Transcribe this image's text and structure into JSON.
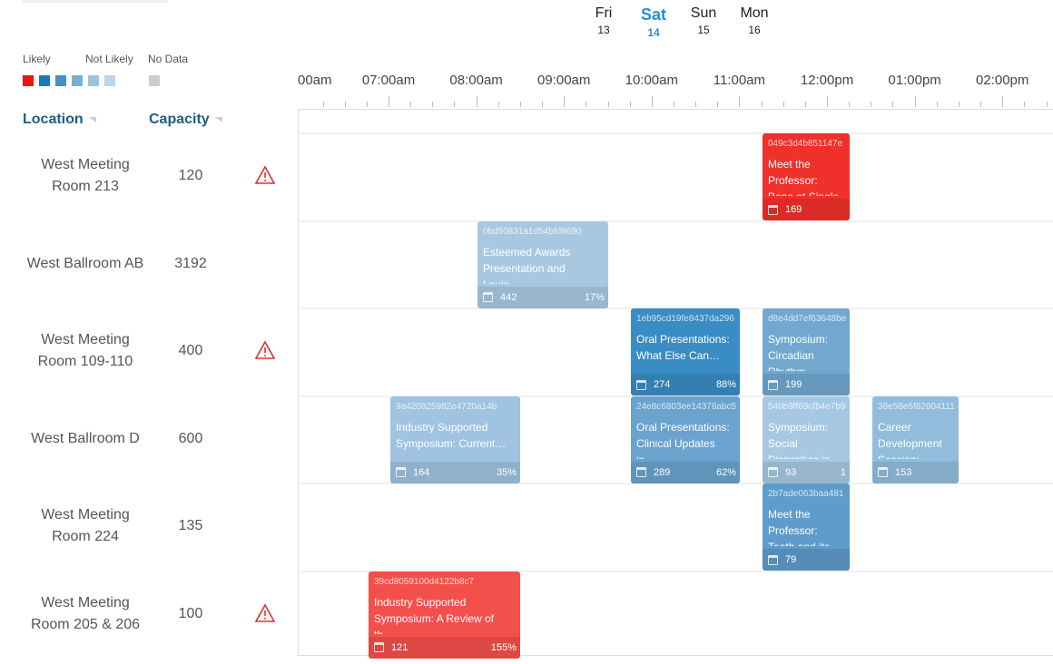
{
  "days": [
    {
      "name": "Fri",
      "date": "13"
    },
    {
      "name": "Sat",
      "date": "14",
      "selected": true
    },
    {
      "name": "Sun",
      "date": "15"
    },
    {
      "name": "Mon",
      "date": "16"
    }
  ],
  "legend": {
    "likely": "Likely",
    "not_likely": "Not Likely",
    "no_data": "No Data",
    "colors": [
      "#f01010",
      "#1f78b4",
      "#4a90c0",
      "#7aaed0",
      "#9cc4e0",
      "#b9d6ea"
    ],
    "no_data_color": "#cccccc"
  },
  "columns": {
    "location": "Location",
    "capacity": "Capacity"
  },
  "hours": [
    "00am",
    "07:00am",
    "08:00am",
    "09:00am",
    "10:00am",
    "11:00am",
    "12:00pm",
    "01:00pm",
    "02:00pm"
  ],
  "rooms": [
    {
      "name": "West Meeting Room 213",
      "capacity": "120",
      "warning": true
    },
    {
      "name": "West Ballroom AB",
      "capacity": "3192",
      "warning": false
    },
    {
      "name": "West Meeting Room 109-110",
      "capacity": "400",
      "warning": true
    },
    {
      "name": "West Ballroom D",
      "capacity": "600",
      "warning": false
    },
    {
      "name": "West Meeting Room 224",
      "capacity": "135",
      "warning": false
    },
    {
      "name": "West Meeting Room 205 & 206",
      "capacity": "100",
      "warning": true
    }
  ],
  "events": [
    {
      "id": "049c3d4b851147e",
      "title": "Meet the Professor: Bone at Single Cell",
      "count": "169",
      "pct": "",
      "color": "#f0302b"
    },
    {
      "id": "0bd50831a1d54bfd8690",
      "title": "Esteemed Awards Presentation and Louis…",
      "count": "442",
      "pct": "17%",
      "color": "#a8c8e2"
    },
    {
      "id": "1eb95cd19fe8437da296",
      "title": "Oral Presentations: What Else Can…",
      "count": "274",
      "pct": "88%",
      "color": "#3a8cc4"
    },
    {
      "id": "d8e4dd7ef63648be",
      "title": "Symposium: Circadian Rhythm",
      "count": "199",
      "pct": "",
      "color": "#72a8d0"
    },
    {
      "id": "9a420825982e4720a14b",
      "title": "Industry Supported Symposium: Current…",
      "count": "164",
      "pct": "35%",
      "color": "#9fc3e0"
    },
    {
      "id": "24e8c6803ee14378abc5",
      "title": "Oral Presentations: Clinical Updates in…",
      "count": "289",
      "pct": "62%",
      "color": "#6aa3cd"
    },
    {
      "id": "540b9ff69cfb4e7b9",
      "title": "Symposium: Social Disparities in…",
      "count": "93",
      "pct": "1",
      "color": "#a7c8e3"
    },
    {
      "id": "38e58e5f82804111",
      "title": "Career Development Session: Navigating",
      "count": "153",
      "pct": "",
      "color": "#92bcdc"
    },
    {
      "id": "2b7ade063baa481",
      "title": "Meet the Professor: Tooth and its…",
      "count": "79",
      "pct": "",
      "color": "#5e9ccb"
    },
    {
      "id": "39cd8059100d4122b8c7",
      "title": "Industry Supported Symposium: A Review of th…",
      "count": "121",
      "pct": "155%",
      "color": "#f4504b"
    }
  ]
}
